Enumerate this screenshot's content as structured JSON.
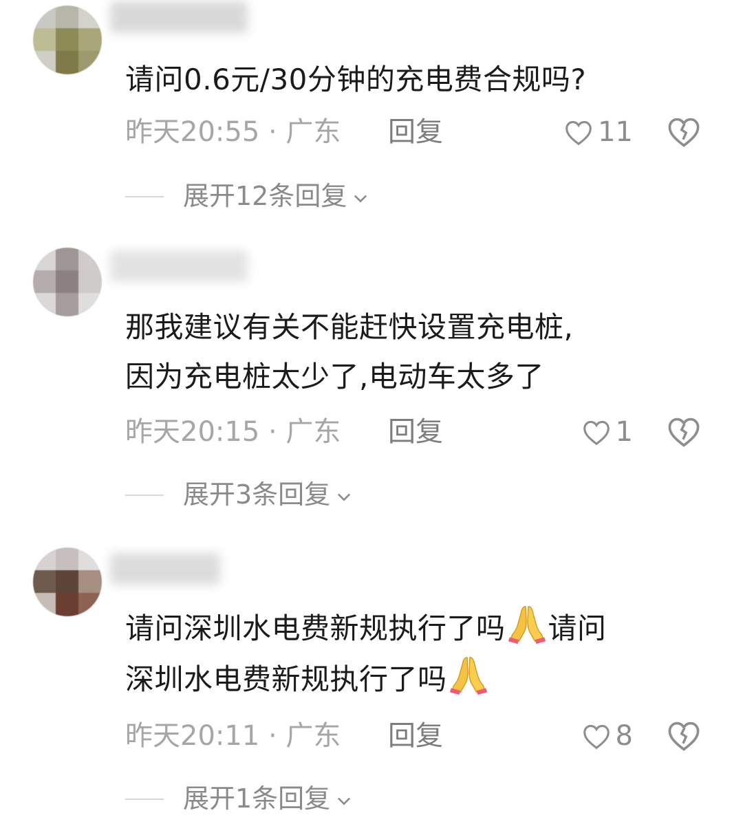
{
  "comments": [
    {
      "text": "请问0.6元/30分钟的充电费合规吗?",
      "time_location": "昨天20:55 · 广东",
      "reply_label": "回复",
      "likes": "11",
      "expand_label": "展开12条回复"
    },
    {
      "text_line1": "那我建议有关不能赶快设置充电桩,",
      "text_line2": "因为充电桩太少了,电动车太多了",
      "time_location": "昨天20:15 · 广东",
      "reply_label": "回复",
      "likes": "1",
      "expand_label": "展开3条回复"
    },
    {
      "text_line1a": "请问深圳水电费新规执行了吗",
      "text_line1b": "请问",
      "text_line2": "深圳水电费新规执行了吗",
      "time_location": "昨天20:11 · 广东",
      "reply_label": "回复",
      "likes": "8",
      "expand_label": "展开1条回复"
    }
  ],
  "icons": {
    "like": "heart-outline-icon",
    "dislike": "broken-heart-icon",
    "expand": "chevron-down-icon",
    "emoji": "folded-hands-emoji"
  },
  "colors": {
    "text": "#1b1b1b",
    "meta": "#a6a6a6",
    "reply": "#7d7d7d"
  }
}
